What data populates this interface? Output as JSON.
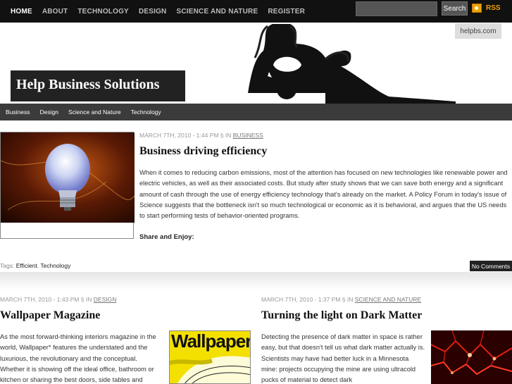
{
  "topnav": {
    "items": [
      "HOME",
      "ABOUT",
      "TECHNOLOGY",
      "DESIGN",
      "SCIENCE AND NATURE",
      "REGISTER"
    ],
    "search_button": "Search",
    "search_placeholder": "",
    "rss_label": "RSS"
  },
  "header": {
    "site_badge": "helpbs.com",
    "site_title": "Help Business Solutions"
  },
  "catbar": {
    "items": [
      "Business",
      "Design",
      "Science and Nature",
      "Technology"
    ]
  },
  "featured": {
    "meta_date": "MARCH 7TH, 2010 - 1:44 PM § IN",
    "meta_category": "BUSINESS",
    "title": "Business driving efficiency",
    "excerpt": "When it comes to reducing carbon emissions, most of the attention has focused on new technologies like renewable power and electric vehicles, as well as their associated costs. But study after study shows that we can save both energy and a significant amount of cash through the use of energy efficiency technology that's already on the market. A Policy Forum in today's issue of Science suggests that the bottleneck isn't so much technological or economic as it is behavioral, and argues that the US needs to start performing tests of behavior-oriented programs.",
    "share": "Share and Enjoy:",
    "tags_label": "Tags:",
    "tags": [
      "Efficient",
      "Technology"
    ],
    "comments": "No Comments"
  },
  "post2": {
    "meta_date": "MARCH 7TH, 2010 - 1:43 PM § IN",
    "meta_category": "DESIGN",
    "title": "Wallpaper Magazine",
    "excerpt": "As the most forward-thinking interiors magazine in the world, Wallpaper* features the understated and the luxurious, the revolutionary and the conceptual. Whether it is showing off the ideal office, bathroom or kitchen or sharing the best doors, side tables and",
    "image_text": "Wallpaper*"
  },
  "post3": {
    "meta_date": "MARCH 7TH, 2010 - 1:37 PM § IN",
    "meta_category": "SCIENCE AND NATURE",
    "title": "Turning the light on Dark Matter",
    "excerpt": "Detecting the presence of dark matter in space is rather easy, but that doesn't tell us what dark matter actually is. Scientists may have had better luck in a Minnesota mine: projects occupying the mine are using ultracold pucks of material to detect dark"
  },
  "colors": {
    "topbar": "#111111",
    "catbar": "#3b3b3b",
    "rss": "#f3a200",
    "title_block": "#222222"
  },
  "icons": {
    "rss": "rss-icon",
    "bulb": "lightbulb-image"
  }
}
